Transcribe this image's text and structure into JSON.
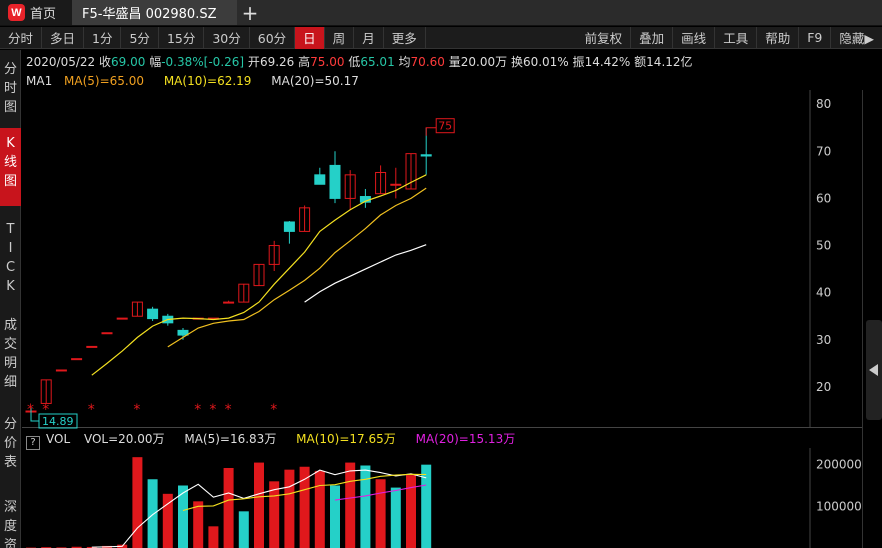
{
  "titlebar": {
    "home_label": "首页",
    "logo_letter": "W",
    "active_tab": "F5-华盛昌 002980.SZ",
    "new_tab": "+"
  },
  "toolbar": {
    "left": [
      "分时",
      "多日",
      "1分",
      "5分",
      "15分",
      "30分",
      "60分",
      "日",
      "周",
      "月",
      "更多"
    ],
    "selected": "日",
    "right": [
      "前复权",
      "叠加",
      "画线",
      "工具",
      "帮助",
      "F9",
      "隐藏▶"
    ]
  },
  "leftnav": [
    {
      "label": "分时图",
      "selected": false
    },
    {
      "label": "K线图",
      "selected": true
    },
    {
      "label": "TICK",
      "selected": false
    },
    {
      "label": "成交明细",
      "selected": false
    },
    {
      "label": "分价表",
      "selected": false
    },
    {
      "label": "深度资",
      "selected": false
    }
  ],
  "quote": {
    "date": "2020/05/22",
    "close_label": "收",
    "close": "69.00",
    "change_label": "幅",
    "change": "-0.38%[-0.26]",
    "open_label": "开",
    "open": "69.26",
    "high_label": "高",
    "high": "75.00",
    "low_label": "低",
    "low": "65.01",
    "avg_label": "均",
    "avg": "70.60",
    "volume_label": "量",
    "volume": "20.00万",
    "turnover_label": "换",
    "turnover": "60.01%",
    "amplitude_label": "振",
    "amplitude": "14.42%",
    "amount_label": "额",
    "amount": "14.12亿"
  },
  "ma_bar": {
    "name": "MA1",
    "ma5": "MA(5)=65.00",
    "ma10": "MA(10)=62.19",
    "ma20": "MA(20)=50.17"
  },
  "vol_bar": {
    "help": "?",
    "name": "VOL",
    "vol": "VOL=20.00万",
    "ma5": "MA(5)=16.83万",
    "ma10": "MA(10)=17.65万",
    "ma20": "MA(20)=15.13万"
  },
  "colors": {
    "up": "#e0181c",
    "down": "#25d0c8",
    "ma5": "#ffffff",
    "ma10": "#f3e020",
    "ma20": "#e020e0",
    "selected": "#c8141c"
  },
  "chart_data": [
    {
      "type": "candlestick",
      "y_ticks": [
        20,
        30,
        40,
        50,
        60,
        70,
        80
      ],
      "ylim": [
        11.5,
        83
      ],
      "high_marker": "75",
      "low_marker": "14.89",
      "candles": [
        {
          "o": 14.89,
          "h": 14.89,
          "l": 14.89,
          "c": 14.89
        },
        {
          "o": 16.5,
          "h": 21.5,
          "l": 16.5,
          "c": 21.5
        },
        {
          "o": 23.6,
          "h": 23.6,
          "l": 23.6,
          "c": 23.6
        },
        {
          "o": 26.0,
          "h": 26.0,
          "l": 26.0,
          "c": 26.0
        },
        {
          "o": 28.6,
          "h": 28.6,
          "l": 28.6,
          "c": 28.6
        },
        {
          "o": 31.5,
          "h": 31.5,
          "l": 31.5,
          "c": 31.5
        },
        {
          "o": 34.6,
          "h": 34.6,
          "l": 34.6,
          "c": 34.6
        },
        {
          "o": 35.0,
          "h": 38.0,
          "l": 35.0,
          "c": 38.0
        },
        {
          "o": 36.5,
          "h": 37.0,
          "l": 34.0,
          "c": 34.5
        },
        {
          "o": 35.0,
          "h": 35.5,
          "l": 33.0,
          "c": 33.6
        },
        {
          "o": 32.0,
          "h": 32.5,
          "l": 30.0,
          "c": 31.0
        },
        {
          "o": 34.6,
          "h": 34.6,
          "l": 34.6,
          "c": 34.6
        },
        {
          "o": 34.6,
          "h": 34.6,
          "l": 34.6,
          "c": 34.6
        },
        {
          "o": 38.0,
          "h": 38.3,
          "l": 38.0,
          "c": 38.0
        },
        {
          "o": 38.0,
          "h": 41.8,
          "l": 38.0,
          "c": 41.8
        },
        {
          "o": 41.5,
          "h": 46.0,
          "l": 41.5,
          "c": 46.0
        },
        {
          "o": 46.0,
          "h": 51.0,
          "l": 44.6,
          "c": 50.0
        },
        {
          "o": 55.0,
          "h": 55.2,
          "l": 50.4,
          "c": 53.0
        },
        {
          "o": 53.0,
          "h": 58.5,
          "l": 53.0,
          "c": 58.0
        },
        {
          "o": 65.0,
          "h": 66.5,
          "l": 64.0,
          "c": 63.0
        },
        {
          "o": 67.0,
          "h": 70.0,
          "l": 59.0,
          "c": 60.0
        },
        {
          "o": 60.0,
          "h": 66.0,
          "l": 57.5,
          "c": 65.0
        },
        {
          "o": 60.4,
          "h": 62.0,
          "l": 58.0,
          "c": 59.2
        },
        {
          "o": 61.0,
          "h": 67.0,
          "l": 61.0,
          "c": 65.5
        },
        {
          "o": 63.0,
          "h": 66.5,
          "l": 60.0,
          "c": 63.0
        },
        {
          "o": 62.0,
          "h": 69.5,
          "l": 62.0,
          "c": 69.5
        },
        {
          "o": 69.26,
          "h": 75.0,
          "l": 65.01,
          "c": 69.0
        }
      ],
      "ma5": [
        null,
        null,
        null,
        null,
        22.5,
        25.0,
        27.6,
        30.5,
        32.9,
        34.3,
        34.6,
        34.5,
        34.3,
        34.6,
        35.8,
        38.0,
        41.8,
        45.2,
        48.6,
        53.0,
        55.4,
        57.6,
        59.4,
        60.5,
        61.7,
        63.4,
        65.0
      ],
      "ma10": [
        null,
        null,
        null,
        null,
        null,
        null,
        null,
        null,
        null,
        28.5,
        30.5,
        32.5,
        33.5,
        34.0,
        34.3,
        36.0,
        38.5,
        40.5,
        42.6,
        45.2,
        48.5,
        51.0,
        53.6,
        56.5,
        58.5,
        60.0,
        62.19
      ],
      "ma20": [
        null,
        null,
        null,
        null,
        null,
        null,
        null,
        null,
        null,
        null,
        null,
        null,
        null,
        null,
        null,
        null,
        null,
        null,
        38.0,
        40.2,
        42.0,
        43.5,
        45.0,
        46.5,
        48.0,
        49.0,
        50.17
      ],
      "stars_at": [
        0,
        1,
        4,
        7,
        11,
        12,
        13,
        16
      ]
    },
    {
      "type": "bar",
      "y_ticks": [
        100000,
        200000
      ],
      "ylim": [
        0,
        240000
      ],
      "volumes": [
        1000,
        2000,
        1500,
        3000,
        2500,
        5000,
        8000,
        218000,
        165000,
        130000,
        150000,
        112000,
        52000,
        192000,
        88000,
        205000,
        160000,
        188000,
        195000,
        185000,
        150000,
        205000,
        198000,
        165000,
        145000,
        175000,
        200000
      ],
      "up": [
        true,
        true,
        true,
        true,
        true,
        true,
        true,
        true,
        false,
        true,
        false,
        true,
        true,
        true,
        false,
        true,
        true,
        true,
        true,
        true,
        false,
        true,
        false,
        true,
        false,
        true,
        false
      ],
      "ma5": [
        null,
        null,
        null,
        null,
        2000,
        2800,
        4000,
        48000,
        80000,
        106000,
        132000,
        153000,
        122000,
        132000,
        119000,
        130000,
        140000,
        147000,
        165000,
        187000,
        176000,
        185000,
        187000,
        181000,
        173000,
        178000,
        168300
      ],
      "ma10": [
        null,
        null,
        null,
        null,
        null,
        null,
        null,
        null,
        null,
        null,
        90000,
        100000,
        101000,
        115000,
        118000,
        123000,
        125000,
        130000,
        140000,
        150000,
        152000,
        160000,
        165000,
        172000,
        175000,
        177000,
        176500
      ],
      "ma20": [
        null,
        null,
        null,
        null,
        null,
        null,
        null,
        null,
        null,
        null,
        null,
        null,
        null,
        null,
        null,
        null,
        null,
        null,
        null,
        null,
        115000,
        120000,
        125000,
        132000,
        138000,
        145000,
        151300
      ]
    }
  ]
}
